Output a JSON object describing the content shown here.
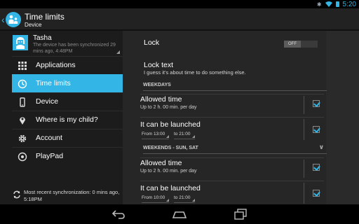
{
  "status_bar": {
    "time": "5:20",
    "icons": [
      "bluetooth-icon",
      "wifi-icon",
      "battery-icon"
    ]
  },
  "action_bar": {
    "title": "Time limits",
    "subtitle": "Device"
  },
  "profile": {
    "name": "Tasha",
    "note": "The device has been synchronized 29 mins ago, 4:48PM"
  },
  "nav": {
    "items": [
      {
        "label": "Applications",
        "icon": "grid-icon"
      },
      {
        "label": "Time limits",
        "icon": "clock-icon",
        "active": true
      },
      {
        "label": "Device",
        "icon": "phone-icon"
      },
      {
        "label": "Where is my child?",
        "icon": "location-pin-icon"
      },
      {
        "label": "Account",
        "icon": "gear-icon"
      },
      {
        "label": "PlayPad",
        "icon": "playpad-icon"
      }
    ]
  },
  "sync": {
    "text": "Most recent synchronization: 0 mins ago, 5:18PM"
  },
  "content": {
    "lock": {
      "label": "Lock",
      "toggle": "OFF"
    },
    "lock_text": {
      "title": "Lock text",
      "value": "I guess it's about time to do something else."
    },
    "weekdays": {
      "header": "WEEKDAYS",
      "allowed_time": {
        "title": "Allowed time",
        "sub": "Up to 2 h. 00 min. per day",
        "checked": true
      },
      "launch": {
        "title": "It can be launched",
        "from": "From 13:00",
        "to": "to 21:00",
        "checked": true
      }
    },
    "weekends": {
      "header": "WEEKENDS - SUN, SAT",
      "allowed_time": {
        "title": "Allowed time",
        "sub": "Up to 2 h. 00 min. per day",
        "checked": true
      },
      "launch": {
        "title": "It can be launched",
        "from": "From 10:00",
        "to": "to 21:00",
        "checked": true
      }
    }
  },
  "colors": {
    "accent": "#33b5e5",
    "drawer_bg": "#1c1c1c",
    "content_bg": "#2a2a2a",
    "card_bg": "#262626"
  }
}
